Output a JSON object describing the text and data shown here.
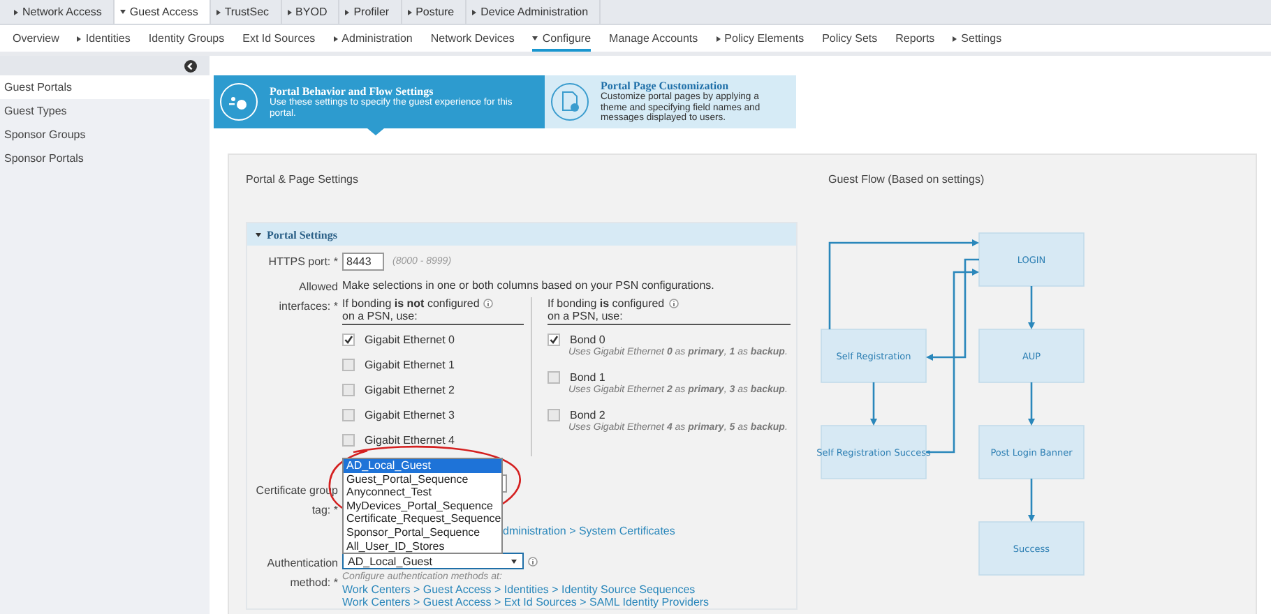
{
  "top_tabs": [
    {
      "label": "Network Access",
      "menu": true,
      "selected": false
    },
    {
      "label": "Guest Access",
      "menu": true,
      "selected": true
    },
    {
      "label": "TrustSec",
      "menu": true,
      "selected": false
    },
    {
      "label": "BYOD",
      "menu": true,
      "selected": false
    },
    {
      "label": "Profiler",
      "menu": true,
      "selected": false
    },
    {
      "label": "Posture",
      "menu": true,
      "selected": false
    },
    {
      "label": "Device Administration",
      "menu": true,
      "selected": false
    }
  ],
  "sub_tabs": [
    {
      "label": "Overview",
      "menu": false,
      "selected": false
    },
    {
      "label": "Identities",
      "menu": true,
      "selected": false
    },
    {
      "label": "Identity Groups",
      "menu": false,
      "selected": false
    },
    {
      "label": "Ext Id Sources",
      "menu": false,
      "selected": false
    },
    {
      "label": "Administration",
      "menu": true,
      "selected": false
    },
    {
      "label": "Network Devices",
      "menu": false,
      "selected": false
    },
    {
      "label": "Configure",
      "menu": true,
      "selected": true
    },
    {
      "label": "Manage Accounts",
      "menu": false,
      "selected": false
    },
    {
      "label": "Policy Elements",
      "menu": true,
      "selected": false
    },
    {
      "label": "Policy Sets",
      "menu": false,
      "selected": false
    },
    {
      "label": "Reports",
      "menu": false,
      "selected": false
    },
    {
      "label": "Settings",
      "menu": true,
      "selected": false
    }
  ],
  "sidebar": {
    "items": [
      {
        "label": "Guest Portals",
        "selected": true
      },
      {
        "label": "Guest Types",
        "selected": false
      },
      {
        "label": "Sponsor Groups",
        "selected": false
      },
      {
        "label": "Sponsor Portals",
        "selected": false
      }
    ]
  },
  "steps": [
    {
      "title": "Portal Behavior and Flow Settings",
      "description": "Use these settings to specify the guest experience for this portal.",
      "selected": true
    },
    {
      "title": "Portal Page Customization",
      "description": "Customize portal pages by applying a theme and specifying field names and messages displayed to users.",
      "selected": false
    }
  ],
  "panel": {
    "title": "Portal & Page Settings",
    "flow_title": "Guest Flow (Based on settings)"
  },
  "portal_settings": {
    "title": "Portal Settings",
    "expanded": true,
    "https_port": {
      "label": "HTTPS port: *",
      "value": "8443",
      "range": "(8000 - 8999)"
    },
    "allowed_interfaces": {
      "label_lines": [
        "Allowed",
        "interfaces: *"
      ],
      "instructions": "Make selections in one or both columns based on your PSN configurations.",
      "columns": [
        {
          "heading": "If bonding **is not** configured",
          "heading_line2": "on a PSN, use:",
          "options": [
            {
              "label": "Gigabit Ethernet 0",
              "checked": true
            },
            {
              "label": "Gigabit Ethernet 1",
              "checked": false
            },
            {
              "label": "Gigabit Ethernet 2",
              "checked": false
            },
            {
              "label": "Gigabit Ethernet 3",
              "checked": false
            },
            {
              "label": "Gigabit Ethernet 4",
              "checked": false
            }
          ]
        },
        {
          "heading": "If bonding **is** configured",
          "heading_line2": "on a PSN, use:",
          "options": [
            {
              "label": "Bond 0",
              "checked": true,
              "note": "Uses Gigabit Ethernet **0** as **primary**, **1** as **backup**."
            },
            {
              "label": "Bond 1",
              "checked": false,
              "note": "Uses Gigabit Ethernet **2** as **primary**, **3** as **backup**."
            },
            {
              "label": "Bond 2",
              "checked": false,
              "note": "Uses Gigabit Ethernet **4** as **primary**, **5** as **backup**."
            }
          ]
        }
      ]
    },
    "certificate_group_tag": {
      "label_lines": [
        "Certificate group",
        "tag: *"
      ],
      "link": "dministration > System Certificates"
    },
    "authentication_method": {
      "label_lines": [
        "Authentication",
        "method: *"
      ],
      "value": "AD_Local_Guest",
      "open": true,
      "options": [
        {
          "label": "AD_Local_Guest",
          "selected": true
        },
        {
          "label": "Guest_Portal_Sequence",
          "selected": false
        },
        {
          "label": "Anyconnect_Test",
          "selected": false
        },
        {
          "label": "MyDevices_Portal_Sequence",
          "selected": false
        },
        {
          "label": "Certificate_Request_Sequence",
          "selected": false
        },
        {
          "label": "Sponsor_Portal_Sequence",
          "selected": false
        },
        {
          "label": "All_User_ID_Stores",
          "selected": false
        }
      ],
      "hint": "Configure authentication methods at:",
      "links": [
        "Work Centers > Guest Access > Identities > Identity Source Sequences",
        "Work Centers > Guest Access > Ext Id Sources > SAML Identity Providers"
      ]
    }
  },
  "guest_flow": {
    "nodes": [
      {
        "label": "LOGIN"
      },
      {
        "label": "Self Registration"
      },
      {
        "label": "AUP"
      },
      {
        "label": "Self Registration Success"
      },
      {
        "label": "Post Login Banner"
      },
      {
        "label": "Success"
      }
    ]
  }
}
